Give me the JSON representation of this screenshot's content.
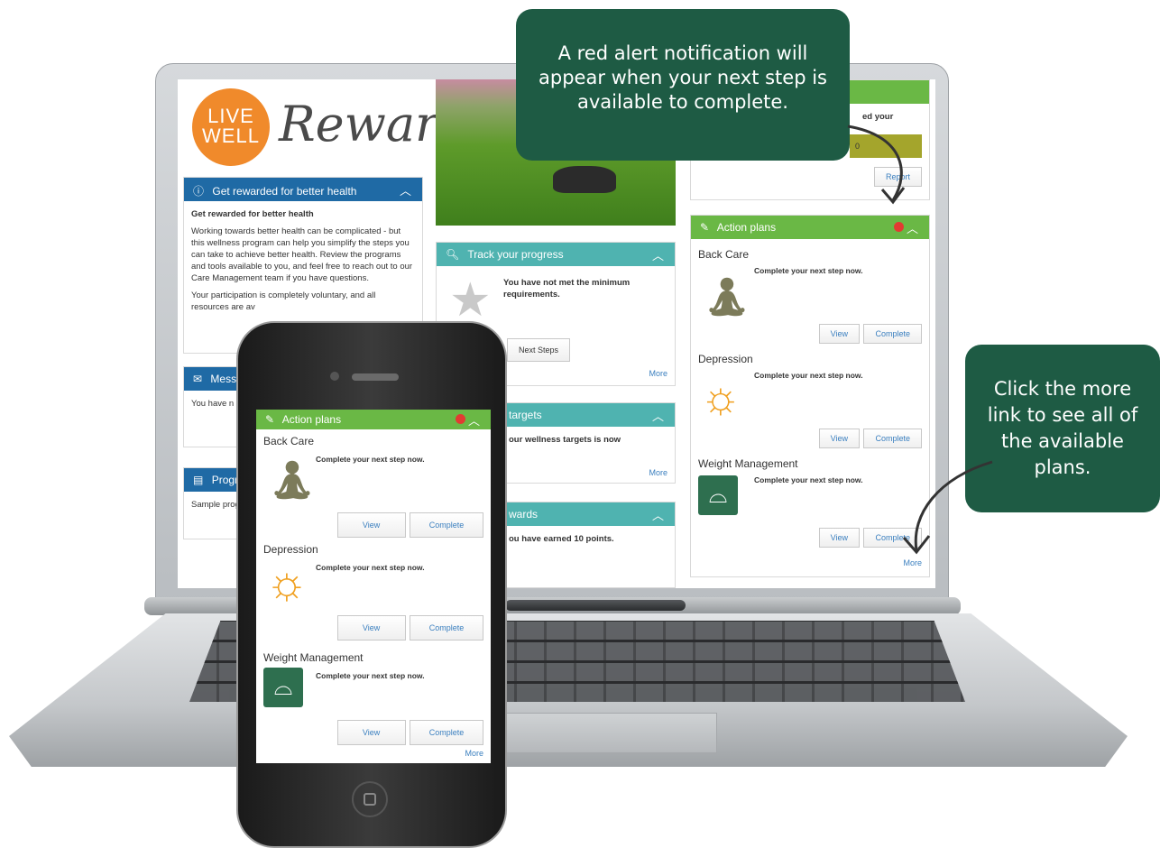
{
  "colors": {
    "callout_bg": "#1e5b44",
    "panel_blue": "#1f6aa5",
    "panel_teal": "#4fb3b0",
    "panel_green": "#6ab845",
    "alert_red": "#e23b32",
    "logo_orange": "#f08a2b"
  },
  "logo": {
    "line1": "LIVE",
    "line2": "WELL",
    "script": "Reward$"
  },
  "callouts": {
    "top": "A red alert notification will appear when your next step is available to complete.",
    "right": "Click the more link to see all of the available plans."
  },
  "get_rewarded": {
    "header": "Get rewarded for better health",
    "title": "Get rewarded for better health",
    "para1": "Working towards better health can be complicated - but this wellness program can help you simplify the steps you can take to achieve better health. Review the programs and tools available to you, and feel free to reach out to our Care Management team if you have questions.",
    "para2": "Your participation is completely voluntary, and all resources are av"
  },
  "messages": {
    "header": "Mess",
    "text": "You have n"
  },
  "programs": {
    "header": "Progr",
    "text": "Sample prog"
  },
  "track": {
    "header": "Track your progress",
    "text": "You have not met the minimum requirements.",
    "next_steps": "Next Steps",
    "more": "More"
  },
  "targets": {
    "header": "targets",
    "text": "our wellness targets is now",
    "more": "More"
  },
  "rewards": {
    "header": "wards",
    "text": "ou have earned 10 points."
  },
  "right_top": {
    "text": "ed your",
    "bar": "0",
    "report": "Report"
  },
  "action_plans": {
    "header": "Action plans",
    "view": "View",
    "complete": "Complete",
    "step": "Complete your next step now.",
    "more": "More",
    "plans": [
      {
        "title": "Back Care",
        "icon": "stretching-figure-icon"
      },
      {
        "title": "Depression",
        "icon": "sun-icon"
      },
      {
        "title": "Weight Management",
        "icon": "scale-icon"
      }
    ]
  }
}
